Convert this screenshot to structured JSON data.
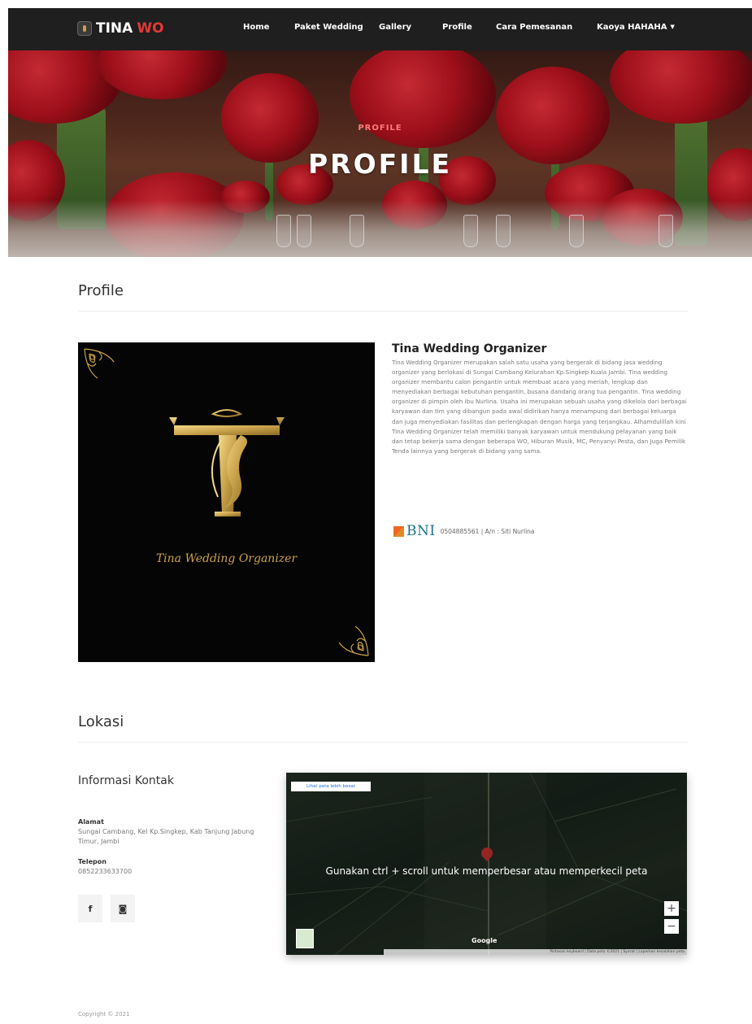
{
  "brand": {
    "part1": "TINA",
    "part2": "WO"
  },
  "nav": {
    "items": [
      {
        "label": "Home"
      },
      {
        "label": "Paket Wedding"
      },
      {
        "label": "Gallery"
      },
      {
        "label": "Profile"
      },
      {
        "label": "Cara Pemesanan"
      },
      {
        "label": "Kaoya HAHAHA"
      }
    ]
  },
  "hero": {
    "subtitle": "PROFILE",
    "title": "PROFILE"
  },
  "profile": {
    "section_title": "Profile",
    "logo_script": "Tina Wedding Organizer",
    "company_name": "Tina Wedding Organizer",
    "description": "Tina Wedding Organizer merupakan salah satu usaha yang bergerak di bidang jasa wedding organizer yang berlokasi di Sungai Cambang Kelurahan Kp.Singkep Kuala Jambi. Tina wedding organizer membantu calon pengantin untuk membuat acara yang meriah, lengkap dan menyediakan berbagai kebutuhan pengantin, busana dandang orang tua pengantin. Tina wedding organizer di pimpin oleh ibu Nurlina. Usaha ini merupakan sebuah usaha yang dikelola dari berbagai karyawan dan tim yang dibangun pada awal didirikan hanya menampung dari berbagai keluarga dan juga menyediakan fasilitas dan perlengkapan dengan harga yang terjangkau. Alhamdulillah kini Tina Wedding Organizer telah memiliki banyak karyawan untuk mendukung pelayanan yang baik dan tetap bekerja sama dengan beberapa WO, Hiburan Musik, MC, Penyanyi Pesta, dan Juga Pemilik Tenda lainnya yang bergerak di bidang yang sama.",
    "bank": {
      "name": "BNI",
      "info": "0504885561 | A/n : Siti Nurlina"
    }
  },
  "location": {
    "section_title": "Lokasi",
    "contact_title": "Informasi Kontak",
    "address_label": "Alamat",
    "address_value": "Sungai Cambang, Kel Kp.Singkep, Kab Tanjung Jabung Timur, Jambi",
    "phone_label": "Telepon",
    "phone_value": "0852233633700",
    "social": {
      "facebook": "f",
      "instagram": "◙"
    }
  },
  "map": {
    "larger_map_link": "Lihat peta lebih besar",
    "overlay_message": "Gunakan ctrl + scroll untuk memperbesar atau memperkecil peta",
    "zoom_in": "+",
    "zoom_out": "−",
    "logo": "Google",
    "attribution": "Pintasan keyboard | Data peta ©2021 | Syarat | Laporkan kesalahan peta"
  },
  "footer": {
    "copyright": "Copyright © 2021"
  },
  "colors": {
    "navbar": "#1f1f1f",
    "brand_accent": "#e53935",
    "gold": "#c9a24a",
    "bni_teal": "#1a6f8c",
    "bni_orange": "#f26522"
  },
  "icons": [
    "brand-logo-icon",
    "caret-down-icon",
    "facebook-icon",
    "instagram-icon",
    "map-pin-icon",
    "bni-logo-icon"
  ]
}
